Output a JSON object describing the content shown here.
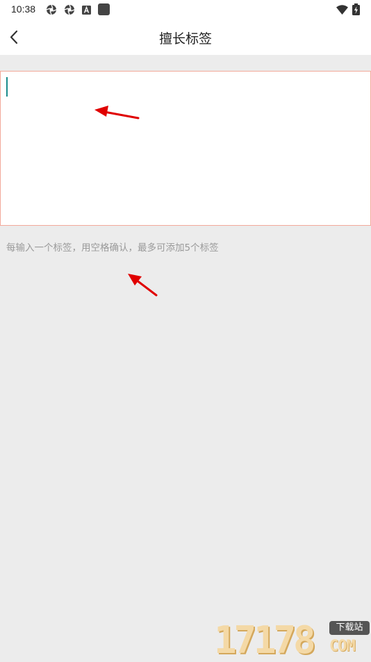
{
  "status_bar": {
    "time": "10:38",
    "left_icons": [
      "aperture-icon",
      "aperture-icon",
      "a-badge-icon",
      "square-icon"
    ],
    "right_icons": [
      "wifi-icon",
      "battery-charging-icon"
    ]
  },
  "header": {
    "back_icon": "chevron-left-icon",
    "title": "擅长标签"
  },
  "tag_input": {
    "value": "",
    "placeholder": ""
  },
  "hint": "每输入一个标签，用空格确认，最多可添加5个标签",
  "annotation_color": "#e00000",
  "watermark": {
    "digits": "17178",
    "badge": "下载站",
    "suffix": "COM"
  }
}
